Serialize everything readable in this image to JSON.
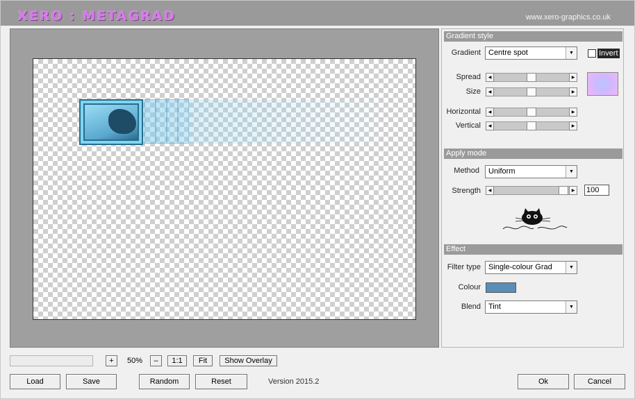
{
  "title": {
    "logo_text": "XERO : METAGRAD",
    "url": "www.xero-graphics.co.uk"
  },
  "gradient_style": {
    "header": "Gradient style",
    "gradient_label": "Gradient",
    "gradient_value": "Centre spot",
    "invert_label": "Invert",
    "invert_checked": false,
    "spread_label": "Spread",
    "size_label": "Size",
    "horizontal_label": "Horizontal",
    "vertical_label": "Vertical",
    "spread_level": 0.5,
    "size_level": 0.5,
    "horizontal_level": 0.5,
    "vertical_level": 0.5,
    "preview_colors": [
      "#b9c7ff",
      "#cdb8ff",
      "#f1b6f5"
    ]
  },
  "apply_mode": {
    "header": "Apply mode",
    "method_label": "Method",
    "method_value": "Uniform",
    "strength_label": "Strength",
    "strength_value": "100",
    "strength_level": 1.0
  },
  "effect": {
    "header": "Effect",
    "filter_type_label": "Filter type",
    "filter_type_value": "Single-colour Grad",
    "colour_label": "Colour",
    "colour_value": "#5a8eb8",
    "blend_label": "Blend",
    "blend_value": "Tint"
  },
  "zoom": {
    "plus": "+",
    "value": "50%",
    "minus": "–",
    "one_to_one": "1:1",
    "fit": "Fit",
    "show_overlay": "Show Overlay"
  },
  "buttons": {
    "load": "Load",
    "save": "Save",
    "random": "Random",
    "reset": "Reset",
    "ok": "Ok",
    "cancel": "Cancel"
  },
  "version": "Version 2015.2",
  "icons": {
    "dropdown": "chevron-down-icon",
    "slider_left": "arrow-left-icon",
    "slider_right": "arrow-right-icon",
    "logo": "cat-logo-icon"
  },
  "colors": {
    "header_bg": "#9a9a9a",
    "logo": "#d57be8"
  }
}
